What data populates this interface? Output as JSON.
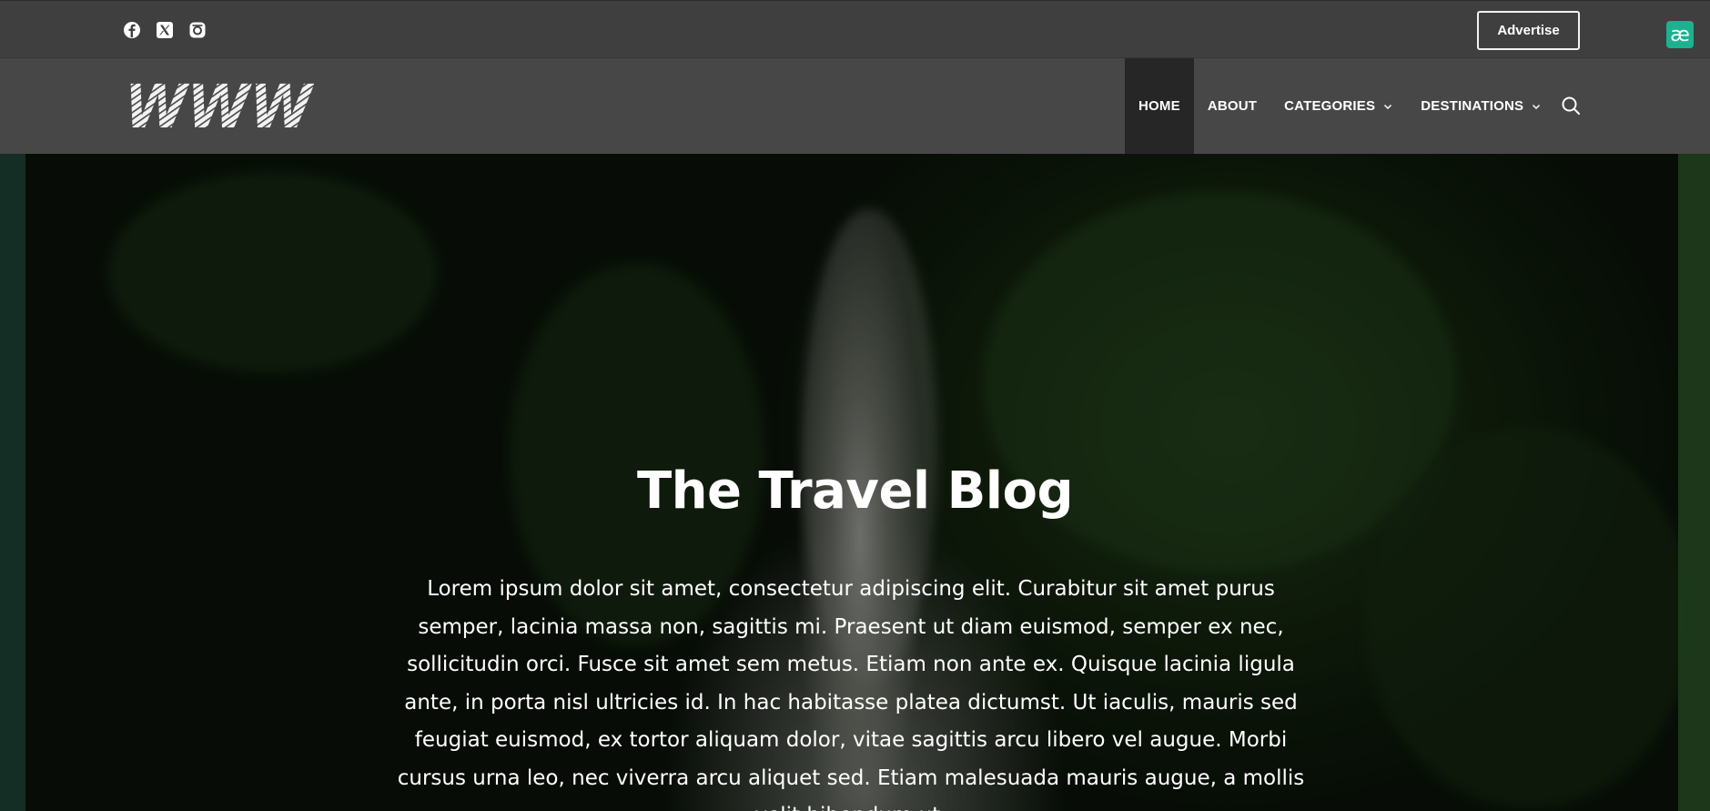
{
  "topbar": {
    "social": [
      {
        "icon": "facebook-icon"
      },
      {
        "icon": "x-twitter-icon"
      },
      {
        "icon": "instagram-icon"
      }
    ],
    "advertise_label": "Advertise",
    "extension_badge": "æ"
  },
  "header": {
    "logo_text": "WWW",
    "nav": [
      {
        "label": "HOME",
        "active": true
      },
      {
        "label": "ABOUT",
        "active": false
      },
      {
        "label": "CATEGORIES",
        "dropdown": true
      },
      {
        "label": "DESTINATIONS",
        "dropdown": true
      }
    ],
    "search_icon": "search-icon"
  },
  "hero": {
    "title": "The Travel Blog",
    "body": "Lorem ipsum dolor sit amet, consectetur adipiscing elit. Curabitur sit amet purus semper, lacinia massa non, sagittis mi. Praesent ut diam euismod, semper ex nec, sollicitudin orci. Fusce sit amet sem metus. Etiam non ante ex. Quisque lacinia ligula ante, in porta nisl ultricies id. In hac habitasse platea dictumst. Ut iaculis, mauris sed feugiat euismod, ex tortor aliquam dolor, vitae sagittis arcu libero vel augue. Morbi cursus urna leo, nec viverra arcu aliquet sed. Etiam malesuada mauris augue, a mollis velit bibendum ut."
  },
  "colors": {
    "topbar": "#3f3f3f",
    "navbar": "#474747",
    "nav_active": "#262626",
    "extension_badge": "#1bb38f"
  }
}
